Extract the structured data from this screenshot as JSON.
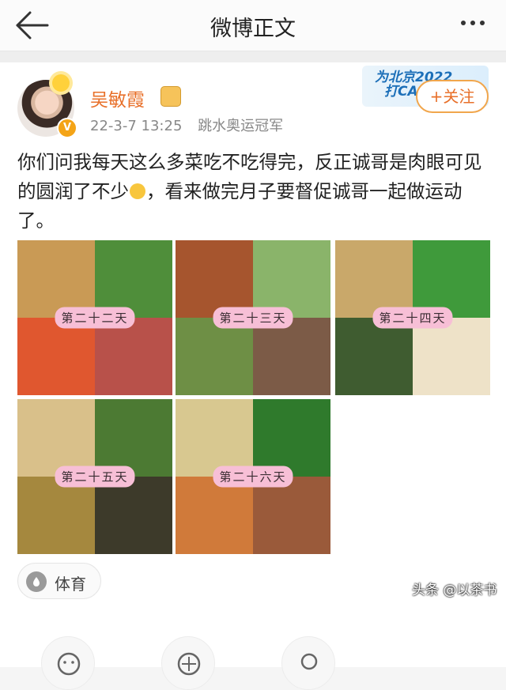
{
  "header": {
    "title": "微博正文"
  },
  "post": {
    "author": "吴敏霞",
    "verified_badge": "V",
    "timestamp": "22-3-7 13:25",
    "source": "跳水奥运冠军",
    "banner_line1": "为北京2022",
    "banner_line2": "打CA",
    "follow_label": "+关注",
    "text_part1": "你们问我每天这么多菜吃不吃得完，反正诚哥是肉眼可见的圆润了不少",
    "text_part2": "，看来做完月子要督促诚哥一起做运动了。",
    "topic_tag": "体育",
    "photos": [
      {
        "label": "第二十二天",
        "cells": [
          "#c99a55",
          "#4f8e3a",
          "#e0572f",
          "#b8514a"
        ]
      },
      {
        "label": "第二十三天",
        "cells": [
          "#a6552e",
          "#8ab46a",
          "#6e8f45",
          "#7c5b47"
        ]
      },
      {
        "label": "第二十四天",
        "cells": [
          "#c9a86a",
          "#3f9a3b",
          "#3f5c30",
          "#eee2c8"
        ]
      },
      {
        "label": "第二十五天",
        "cells": [
          "#d9c08a",
          "#4c7a33",
          "#a5883e",
          "#3d3a2a"
        ]
      },
      {
        "label": "第二十六天",
        "cells": [
          "#d8c890",
          "#2f7a2c",
          "#d07a3a",
          "#9a5a3a"
        ]
      }
    ]
  },
  "watermark": "头条 @以茶书",
  "colors": {
    "accent_orange": "#e8702a",
    "label_pink": "#f7bfd6",
    "follow_border": "#f1a64c"
  },
  "icons": [
    "back-arrow-icon",
    "more-dots-icon",
    "verified-v-icon",
    "crown-icon",
    "topic-icon",
    "share-icon",
    "comment-icon",
    "like-icon"
  ]
}
